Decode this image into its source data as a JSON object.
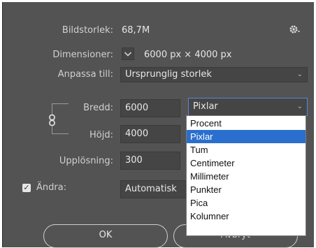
{
  "dialog": {
    "image_size_label": "Bildstorlek:",
    "image_size_value": "68,7M",
    "dimensions_label": "Dimensioner:",
    "dimensions_value": "6000 px  ×  4000 px",
    "fit_to_label": "Anpassa till:",
    "fit_to_value": "Ursprunglig storlek",
    "width_label": "Bredd:",
    "width_value": "6000",
    "width_unit": "Pixlar",
    "height_label": "Höjd:",
    "height_value": "4000",
    "resolution_label": "Upplösning:",
    "resolution_value": "300",
    "resample_label": "Ändra:",
    "resample_value": "Automatisk",
    "ok_label": "OK",
    "cancel_label": "Avbryt"
  },
  "unit_dropdown": {
    "items": [
      "Procent",
      "Pixlar",
      "Tum",
      "Centimeter",
      "Millimeter",
      "Punkter",
      "Pica",
      "Kolumner"
    ],
    "selected": "Pixlar"
  },
  "icons": {
    "settings": "gear-icon",
    "dimensions_toggle": "chevron-down-icon",
    "constrain": "chain-link-icon",
    "resample_check": "checkmark-icon"
  },
  "colors": {
    "dialog_bg": "#535353",
    "field_bg": "#454545",
    "highlight": "#2a6fce",
    "dropdown_border": "#5a86d8"
  }
}
